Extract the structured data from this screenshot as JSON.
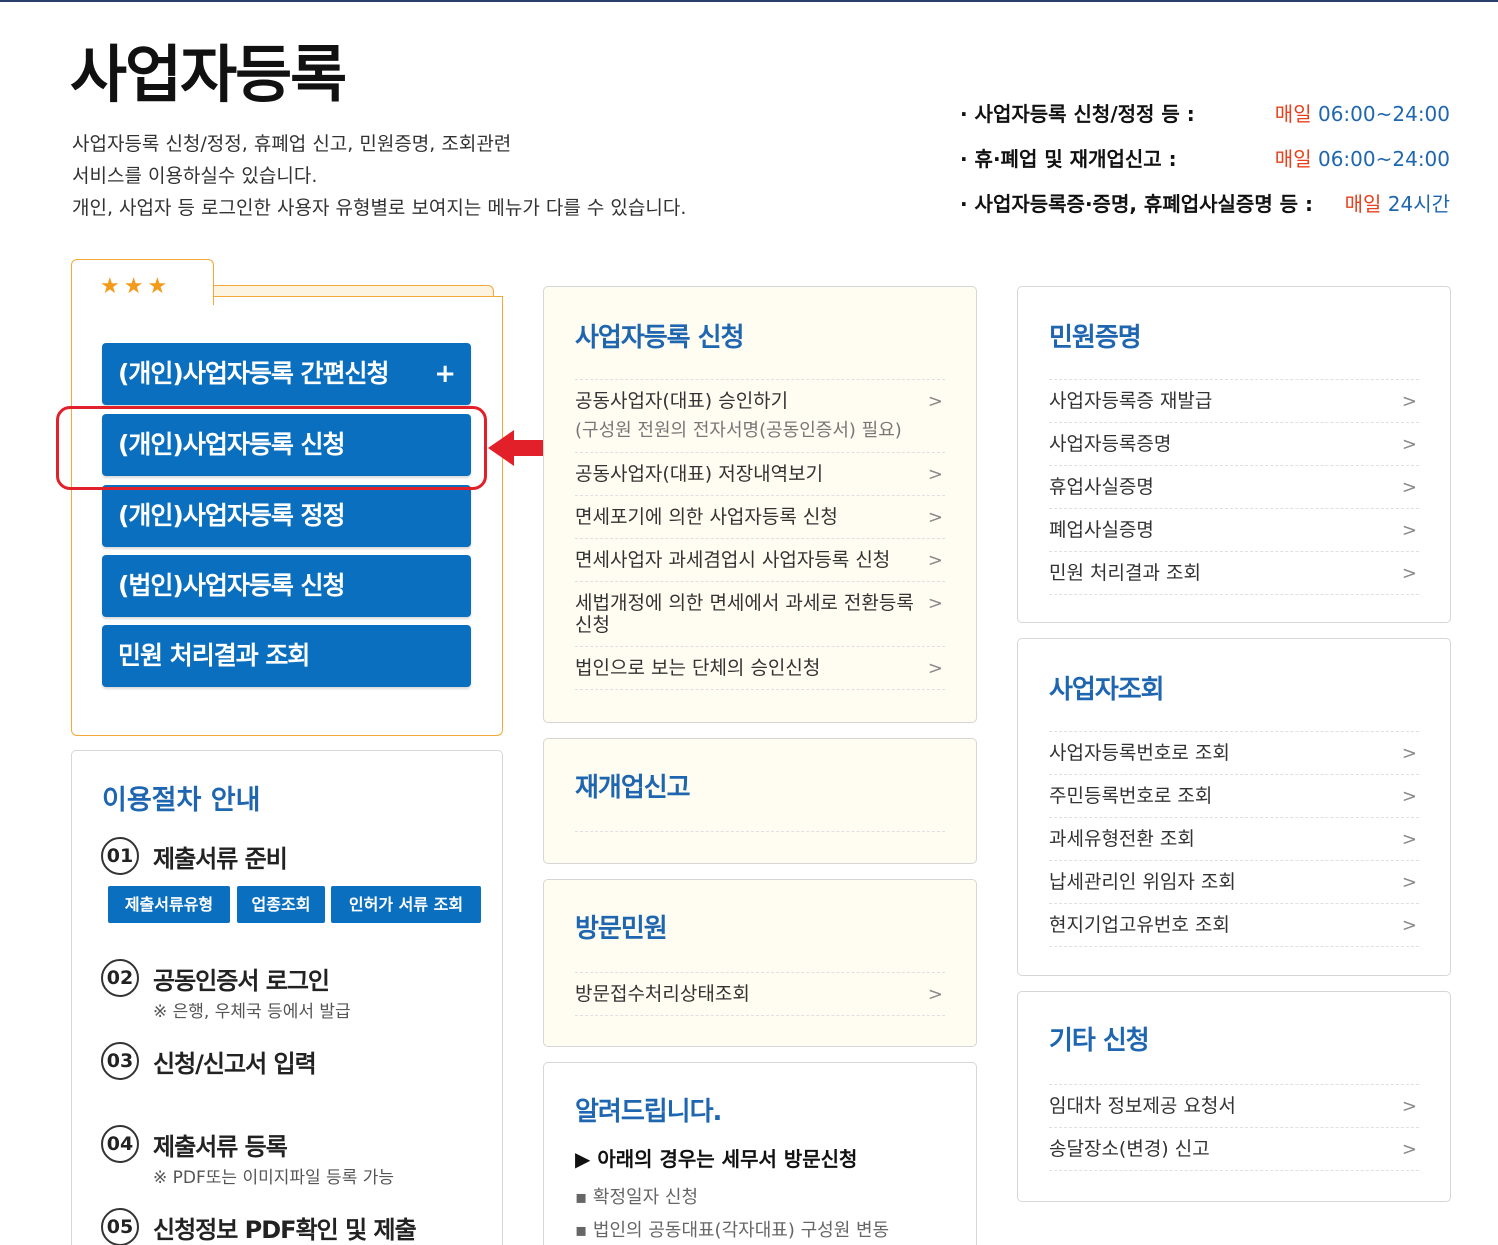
{
  "header": {
    "title": "사업자등록",
    "intro_lines": [
      "사업자등록 신청/정정, 휴폐업 신고, 민원증명, 조회관련",
      "서비스를 이용하실수 있습니다.",
      "개인, 사업자 등 로그인한 사용자 유형별로 보여지는 메뉴가 다를 수 있습니다."
    ]
  },
  "hours": [
    {
      "label": "· 사업자등록 신청/정정 등 :",
      "day": "매일",
      "time": "06:00~24:00"
    },
    {
      "label": "· 휴·폐업 및 재개업신고 :",
      "day": "매일",
      "time": "06:00~24:00"
    },
    {
      "label": "· 사업자등록증·증명, 휴폐업사실증명 등 :",
      "day": "매일",
      "time": "24시간"
    }
  ],
  "favorites": {
    "stars": "★★★",
    "buttons": [
      {
        "label": "(개인)사업자등록 간편신청",
        "plus": "+"
      },
      {
        "label": "(개인)사업자등록 신청"
      },
      {
        "label": "(개인)사업자등록 정정"
      },
      {
        "label": "(법인)사업자등록 신청"
      },
      {
        "label": "민원 처리결과 조회"
      }
    ]
  },
  "procedure": {
    "title": "이용절차 안내",
    "steps": [
      {
        "num": "01",
        "label": "제출서류 준비",
        "note": ""
      },
      {
        "num": "02",
        "label": "공동인증서 로그인",
        "note": "※ 은행, 우체국 등에서 발급"
      },
      {
        "num": "03",
        "label": "신청/신고서 입력",
        "note": ""
      },
      {
        "num": "04",
        "label": "제출서류 등록",
        "note": "※ PDF또는 이미지파일 등록 가능"
      },
      {
        "num": "05",
        "label": "신청정보 PDF확인 및 제출",
        "note": ""
      }
    ],
    "buttons": [
      "제출서류유형",
      "업종조회",
      "인허가 서류 조회"
    ]
  },
  "apply": {
    "title": "사업자등록 신청",
    "items": [
      {
        "label": "공동사업자(대표) 승인하기",
        "sub": "(구성원 전원의 전자서명(공동인증서) 필요)"
      },
      {
        "label": "공동사업자(대표) 저장내역보기"
      },
      {
        "label": "면세포기에 의한 사업자등록 신청"
      },
      {
        "label": "면세사업자 과세겸업시 사업자등록 신청"
      },
      {
        "label": "세법개정에 의한 면세에서 과세로 전환등록 신청"
      },
      {
        "label": "법인으로 보는 단체의 승인신청"
      }
    ]
  },
  "reopen": {
    "title": "재개업신고"
  },
  "visit": {
    "title": "방문민원",
    "items": [
      {
        "label": "방문접수처리상태조회"
      }
    ]
  },
  "notice": {
    "title": "알려드립니다.",
    "head": "▶ 아래의 경우는 세무서 방문신청",
    "items": [
      "▪ 확정일자 신청",
      "▪ 법인의 공동대표(각자대표) 구성원 변동"
    ]
  },
  "certs": {
    "title": "민원증명",
    "items": [
      {
        "label": "사업자등록증 재발급"
      },
      {
        "label": "사업자등록증명"
      },
      {
        "label": "휴업사실증명"
      },
      {
        "label": "폐업사실증명"
      },
      {
        "label": "민원 처리결과 조회"
      }
    ]
  },
  "lookup": {
    "title": "사업자조회",
    "items": [
      {
        "label": "사업자등록번호로 조회"
      },
      {
        "label": "주민등록번호로 조회"
      },
      {
        "label": "과세유형전환 조회"
      },
      {
        "label": "납세관리인 위임자 조회"
      },
      {
        "label": "현지기업고유번호 조회"
      }
    ]
  },
  "etc": {
    "title": "기타 신청",
    "items": [
      {
        "label": "임대차 정보제공 요청서"
      },
      {
        "label": "송달장소(변경) 신고"
      }
    ]
  },
  "icons": {
    "chevron": "chevron-right-icon",
    "arrow": "red-arrow-left-icon"
  },
  "colors": {
    "primary": "#0a6fbf",
    "title_blue": "#1f66b1",
    "accent_red": "#e8401c",
    "fav_border": "#f3a93a",
    "highlight": "#e2202a"
  }
}
